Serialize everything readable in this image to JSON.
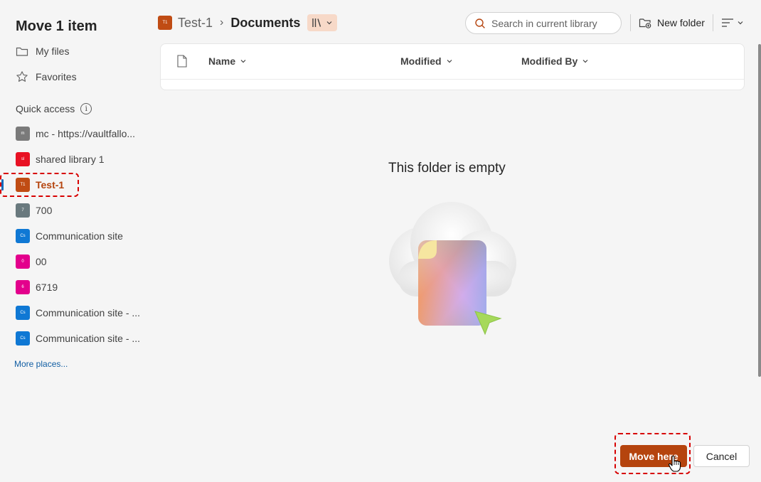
{
  "dialog": {
    "title": "Move 1 item"
  },
  "nav": {
    "my_files": "My files",
    "favorites": "Favorites",
    "quick_access_label": "Quick access",
    "info_glyph": "i",
    "more_places": "More places..."
  },
  "quick_access": [
    {
      "label": "mc - https://vaultfallo...",
      "badge": "m",
      "color": "#7a7a7a"
    },
    {
      "label": "shared library 1",
      "badge": "sl",
      "color": "#e81123"
    },
    {
      "label": "Test-1",
      "badge": "T1",
      "color": "#c04c14",
      "selected": true
    },
    {
      "label": "700",
      "badge": "7",
      "color": "#69797e"
    },
    {
      "label": "Communication site",
      "badge": "Cs",
      "color": "#0f78d4"
    },
    {
      "label": "00",
      "badge": "0",
      "color": "#e3008c"
    },
    {
      "label": "6719",
      "badge": "6",
      "color": "#e3008c"
    },
    {
      "label": "Communication site - ...",
      "badge": "Cs",
      "color": "#0f78d4"
    },
    {
      "label": "Communication site - ...",
      "badge": "Cs",
      "color": "#0f78d4"
    }
  ],
  "breadcrumb": {
    "site_badge": "T1",
    "site": "Test-1",
    "separator": "›",
    "current": "Documents"
  },
  "search": {
    "placeholder": "Search in current library"
  },
  "toolbar": {
    "new_folder": "New folder"
  },
  "table": {
    "columns": [
      "Name",
      "Modified",
      "Modified By"
    ]
  },
  "empty_state": {
    "title": "This folder is empty"
  },
  "footer": {
    "move_here": "Move here",
    "cancel": "Cancel"
  },
  "colors": {
    "accent": "#b5440e",
    "highlight": "#d70000",
    "link": "#115ea3"
  }
}
